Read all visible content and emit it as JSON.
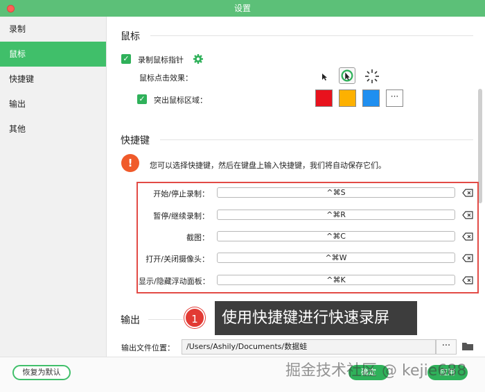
{
  "window": {
    "title": "设置"
  },
  "sidebar": {
    "items": [
      {
        "label": "录制"
      },
      {
        "label": "鼠标"
      },
      {
        "label": "快捷键"
      },
      {
        "label": "输出"
      },
      {
        "label": "其他"
      }
    ],
    "active_index": 1
  },
  "mouse": {
    "section_title": "鼠标",
    "record_pointer_label": "录制鼠标指针",
    "click_effect_label": "鼠标点击效果：",
    "highlight_area_label": "突出鼠标区域：",
    "colors": [
      "#e8121d",
      "#fdb100",
      "#1f8ff0"
    ],
    "more_colors_glyph": "···"
  },
  "hotkeys": {
    "section_title": "快捷键",
    "info_text": "您可以选择快捷键，然后在键盘上输入快捷键，我们将自动保存它们。",
    "info_glyph": "!",
    "rows": [
      {
        "label": "开始/停止录制：",
        "value": "^⌘S"
      },
      {
        "label": "暂停/继续录制：",
        "value": "^⌘R"
      },
      {
        "label": "截图：",
        "value": "^⌘C"
      },
      {
        "label": "打开/关闭摄像头：",
        "value": "^⌘W"
      },
      {
        "label": "显示/隐藏浮动面板：",
        "value": "^⌘K"
      }
    ]
  },
  "output": {
    "section_title": "输出",
    "location_label": "输出文件位置：",
    "path": "/Users/Ashily/Documents/数据蛙",
    "browse_glyph": "···"
  },
  "footer": {
    "reset_label": "恢复为默认",
    "ok_label": "确定",
    "apply_label": "应用"
  },
  "annotation": {
    "number": "1",
    "text": "使用快捷键进行快速录屏"
  },
  "watermark": {
    "text": "掘金技术社区 @ kejie688"
  }
}
